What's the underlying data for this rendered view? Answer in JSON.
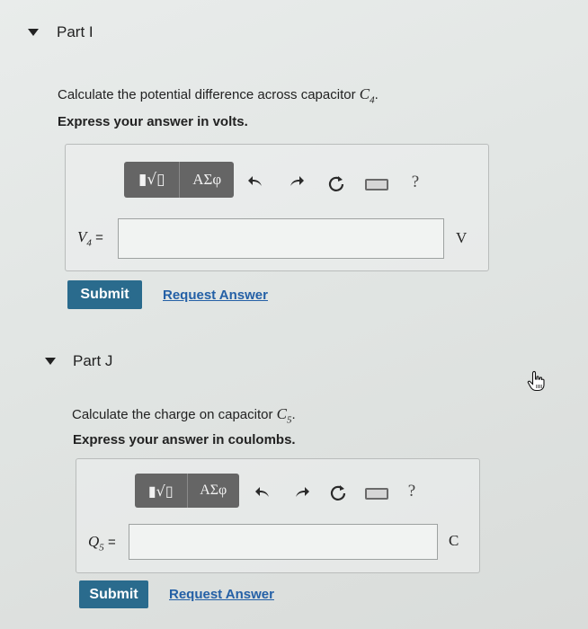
{
  "partI": {
    "title": "Part I",
    "question_text": "Calculate the potential difference across capacitor ",
    "question_var": "C",
    "question_sub": "4",
    "question_end": ".",
    "instruction": "Express your answer in volts.",
    "toolbar": {
      "templates_glyph": "▮√▯",
      "greek": "ΑΣφ",
      "help": "?"
    },
    "var_label": "V",
    "var_sub": "4",
    "equals": "=",
    "input_value": "",
    "unit": "V",
    "submit_label": "Submit",
    "request_label": "Request Answer"
  },
  "partJ": {
    "title": "Part J",
    "question_text": "Calculate the charge on capacitor ",
    "question_var": "C",
    "question_sub": "5",
    "question_end": ".",
    "instruction": "Express your answer in coulombs.",
    "toolbar": {
      "templates_glyph": "▮√▯",
      "greek": "ΑΣφ",
      "help": "?"
    },
    "var_label": "Q",
    "var_sub": "5",
    "equals": "=",
    "input_value": "",
    "unit": "C",
    "submit_label": "Submit",
    "request_label": "Request Answer"
  }
}
